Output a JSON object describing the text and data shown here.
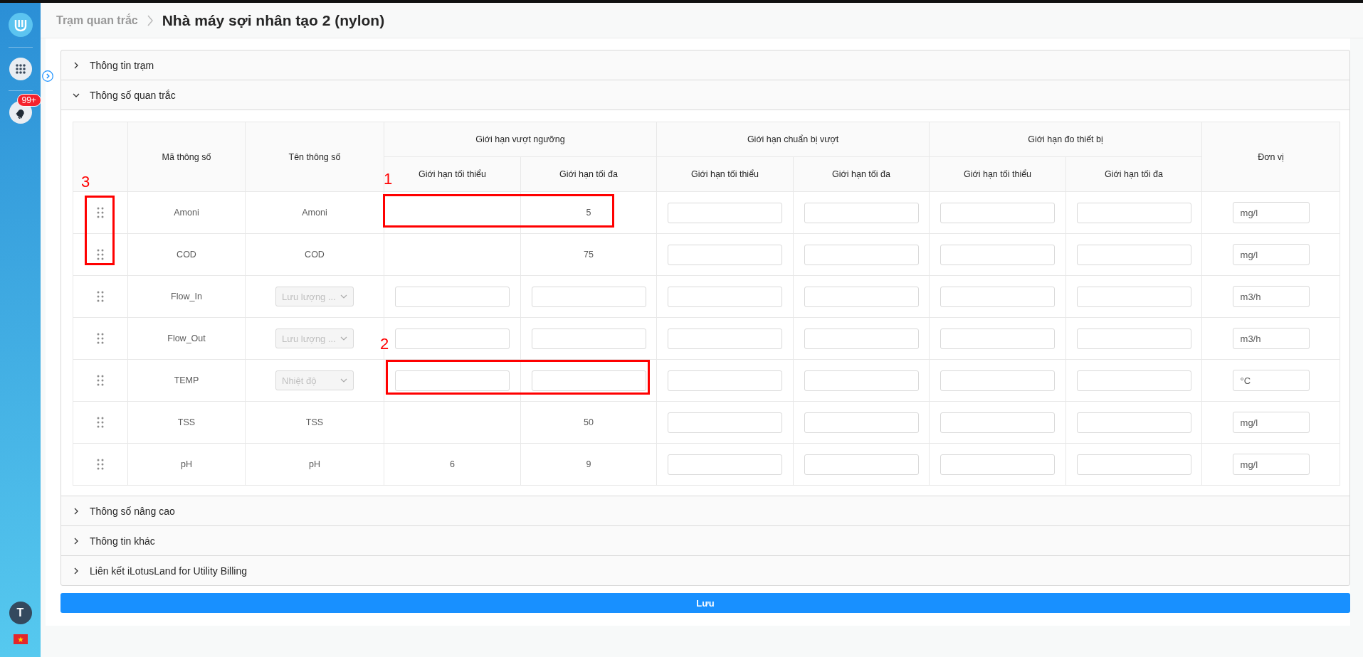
{
  "sidebar": {
    "notification_badge": "99+",
    "avatar_initial": "T"
  },
  "breadcrumb": {
    "parent": "Trạm quan trắc",
    "current": "Nhà máy sợi nhân tạo 2 (nylon)"
  },
  "sections": [
    {
      "title": "Thông tin trạm",
      "expanded": false
    },
    {
      "title": "Thông số quan trắc",
      "expanded": true
    },
    {
      "title": "Thông số nâng cao",
      "expanded": false
    },
    {
      "title": "Thông tin khác",
      "expanded": false
    },
    {
      "title": "Liên kết iLotusLand for Utility Billing",
      "expanded": false
    }
  ],
  "table": {
    "columns": [
      "Mã thông số",
      "Tên thông số"
    ],
    "groups": [
      {
        "title": "Giới hạn vượt ngưỡng",
        "sub": [
          "Giới hạn tối thiểu",
          "Giới hạn tối đa"
        ]
      },
      {
        "title": "Giới hạn chuẩn bị vượt",
        "sub": [
          "Giới hạn tối thiểu",
          "Giới hạn tối đa"
        ]
      },
      {
        "title": "Giới hạn đo thiết bị",
        "sub": [
          "Giới hạn tối thiểu",
          "Giới hạn tối đa"
        ]
      }
    ],
    "unit_column": "Đơn vị",
    "rows": [
      {
        "code": "Amoni",
        "name": {
          "kind": "text",
          "value": "Amoni"
        },
        "limits": [
          {
            "kind": "text"
          },
          {
            "kind": "text",
            "value": "5"
          },
          {
            "kind": "input"
          },
          {
            "kind": "input"
          },
          {
            "kind": "input"
          },
          {
            "kind": "input"
          }
        ],
        "unit": "mg/l"
      },
      {
        "code": "COD",
        "name": {
          "kind": "text",
          "value": "COD"
        },
        "limits": [
          {
            "kind": "text"
          },
          {
            "kind": "text",
            "value": "75"
          },
          {
            "kind": "input"
          },
          {
            "kind": "input"
          },
          {
            "kind": "input"
          },
          {
            "kind": "input"
          }
        ],
        "unit": "mg/l"
      },
      {
        "code": "Flow_In",
        "name": {
          "kind": "select",
          "placeholder": "Lưu lượng ..."
        },
        "limits": [
          {
            "kind": "input"
          },
          {
            "kind": "input"
          },
          {
            "kind": "input"
          },
          {
            "kind": "input"
          },
          {
            "kind": "input"
          },
          {
            "kind": "input"
          }
        ],
        "unit": "m3/h"
      },
      {
        "code": "Flow_Out",
        "name": {
          "kind": "select",
          "placeholder": "Lưu lượng ..."
        },
        "limits": [
          {
            "kind": "input"
          },
          {
            "kind": "input"
          },
          {
            "kind": "input"
          },
          {
            "kind": "input"
          },
          {
            "kind": "input"
          },
          {
            "kind": "input"
          }
        ],
        "unit": "m3/h"
      },
      {
        "code": "TEMP",
        "name": {
          "kind": "select",
          "placeholder": "Nhiệt độ"
        },
        "limits": [
          {
            "kind": "input"
          },
          {
            "kind": "input"
          },
          {
            "kind": "input"
          },
          {
            "kind": "input"
          },
          {
            "kind": "input"
          },
          {
            "kind": "input"
          }
        ],
        "unit": "°C"
      },
      {
        "code": "TSS",
        "name": {
          "kind": "text",
          "value": "TSS"
        },
        "limits": [
          {
            "kind": "text"
          },
          {
            "kind": "text",
            "value": "50"
          },
          {
            "kind": "input"
          },
          {
            "kind": "input"
          },
          {
            "kind": "input"
          },
          {
            "kind": "input"
          }
        ],
        "unit": "mg/l"
      },
      {
        "code": "pH",
        "name": {
          "kind": "text",
          "value": "pH"
        },
        "limits": [
          {
            "kind": "text",
            "value": "6"
          },
          {
            "kind": "text",
            "value": "9"
          },
          {
            "kind": "input"
          },
          {
            "kind": "input"
          },
          {
            "kind": "input"
          },
          {
            "kind": "input"
          }
        ],
        "unit": "mg/l"
      }
    ]
  },
  "annotations": [
    {
      "label": "1"
    },
    {
      "label": "2"
    },
    {
      "label": "3"
    }
  ],
  "save_button": "Lưu"
}
